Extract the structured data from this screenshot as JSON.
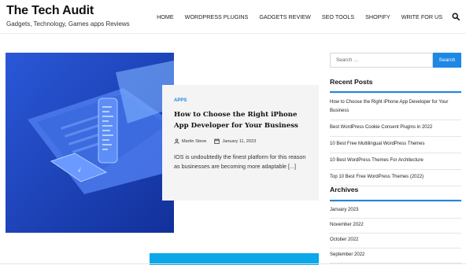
{
  "site": {
    "title": "The Tech Audit",
    "tagline": "Gadgets, Technology, Games apps Reviews"
  },
  "nav": {
    "items": [
      "HOME",
      "WORDPRESS PLUGINS",
      "GADGETS REVIEW",
      "SEO TOOLS",
      "SHOPIFY",
      "WRITE FOR US"
    ],
    "search_icon": "search-icon"
  },
  "post": {
    "category": "APPS",
    "title": "How to Choose the Right iPhone App Developer for Your Business",
    "author": "Martin Steve",
    "date": "January 11, 2023",
    "excerpt": "IOS is undoubtedly the finest platform for this reason as businesses are becoming more adaptable [...]",
    "image_icon": "phone-laptop-illustration"
  },
  "sidebar": {
    "search_placeholder": "Search …",
    "search_button": "Search",
    "recent_title": "Recent Posts",
    "recent_posts": [
      "How to Choose the Right iPhone App Developer for Your Business",
      "Best WordPress Cookie Consent Plugins in 2022",
      "10 Best Free Multilingual WordPress Themes",
      "10 Best WordPress Themes For Architecture",
      "Top 10 Best Free WordPress Themes (2022)"
    ],
    "archives_title": "Archives",
    "archives": [
      "January 2023",
      "November 2022",
      "October 2022",
      "September 2022"
    ]
  },
  "colors": {
    "accent": "#1e88e5",
    "hero_bg": "#1b3fb8",
    "strip": "#0aa8e8"
  }
}
